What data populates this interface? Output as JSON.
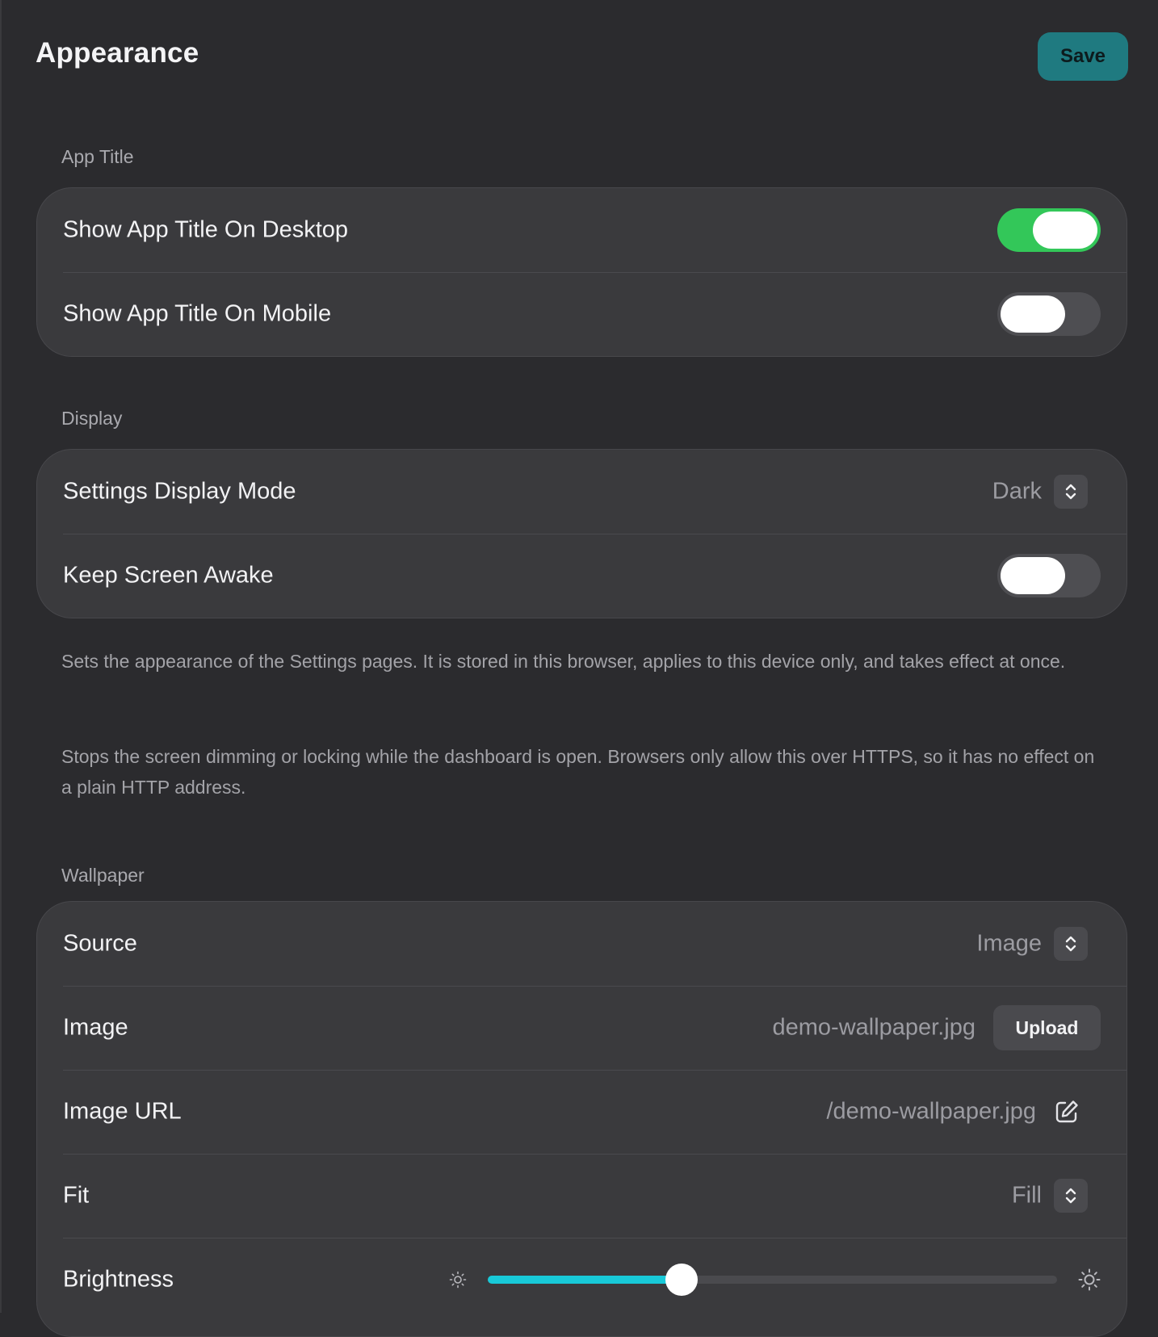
{
  "header": {
    "title": "Appearance",
    "save_label": "Save"
  },
  "app_title": {
    "section_label": "App Title",
    "rows": [
      {
        "label": "Show App Title On Desktop",
        "enabled": true
      },
      {
        "label": "Show App Title On Mobile",
        "enabled": false
      }
    ]
  },
  "display": {
    "section_label": "Display",
    "mode_label": "Settings Display Mode",
    "mode_value": "Dark",
    "awake_label": "Keep Screen Awake",
    "awake_enabled": false,
    "help_mode": "Sets the appearance of the Settings pages. It is stored in this browser, applies to this device only, and takes effect at once.",
    "help_awake": "Stops the screen dimming or locking while the dashboard is open. Browsers only allow this over HTTPS, so it has no effect on a plain HTTP address."
  },
  "wallpaper": {
    "section_label": "Wallpaper",
    "source_label": "Source",
    "source_value": "Image",
    "image_label": "Image",
    "image_value": "demo-wallpaper.jpg",
    "upload_label": "Upload",
    "url_label": "Image URL",
    "url_value": "/demo-wallpaper.jpg",
    "fit_label": "Fit",
    "fit_value": "Fill",
    "brightness_label": "Brightness",
    "brightness_fraction": 0.34
  },
  "colors": {
    "accent": "#1f7a80",
    "toggle_on": "#33c759",
    "slider_fill": "#18c9d8"
  },
  "icons": {
    "stepper": "chevron-up-down-icon",
    "edit": "pencil-square-icon",
    "brightness_low": "sun-small-icon",
    "brightness_high": "sun-large-icon"
  }
}
